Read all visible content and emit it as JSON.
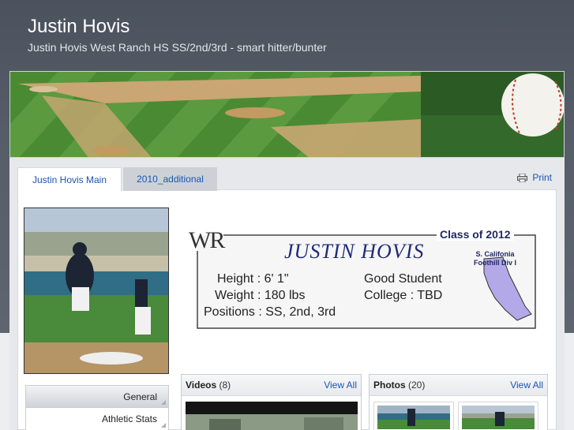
{
  "header": {
    "title": "Justin Hovis",
    "subtitle": "Justin Hovis West Ranch HS SS/2nd/3rd - smart hitter/bunter"
  },
  "tabs": [
    {
      "label": "Justin Hovis Main"
    },
    {
      "label": "2010_additional"
    }
  ],
  "print_label": "Print",
  "card": {
    "logo": "WR",
    "class_label": "Class of 2012",
    "name": "JUSTIN HOVIS",
    "region_line1": "S. Califonia",
    "region_line2": "Foothill Div I",
    "height": "Height :  6' 1\"",
    "weight": "Weight :  180 lbs",
    "positions": "Positions :  SS, 2nd, 3rd",
    "good_student": "Good Student",
    "college": "College :  TBD"
  },
  "side_nav": [
    {
      "label": "General"
    },
    {
      "label": "Athletic Stats"
    }
  ],
  "videos": {
    "title": "Videos",
    "count": "(8)",
    "view_all": "View All"
  },
  "photos": {
    "title": "Photos",
    "count": "(20)",
    "view_all": "View All"
  },
  "colors": {
    "accent": "#1a55b4",
    "header_bg": "#535a65",
    "card_navy": "#1f2a7a"
  }
}
